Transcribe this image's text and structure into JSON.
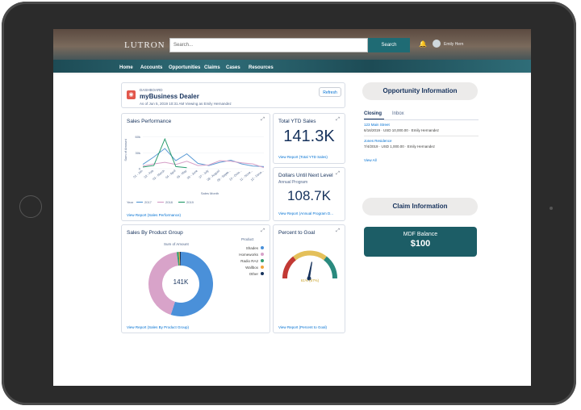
{
  "header": {
    "logo": "LUTRON",
    "search_placeholder": "Search...",
    "search_button": "Search",
    "user_name": "Emily Hern"
  },
  "nav": [
    "Home",
    "Accounts",
    "Opportunities",
    "Claims",
    "Cases",
    "Resources"
  ],
  "dashboard": {
    "label": "DASHBOARD",
    "title": "myBusiness Dealer",
    "subtitle": "As of Jun 5, 2019 10:31 AM Viewing as Emily Hernandez",
    "refresh": "Refresh"
  },
  "cards": {
    "sales_performance": {
      "title": "Sales Performance",
      "link": "View Report (Sales Performance)",
      "ylabel": "Sum of Amount",
      "xlabel": "Sales Month",
      "legend_label": "Year"
    },
    "ytd": {
      "title": "Total YTD Sales",
      "value": "141.3K",
      "link": "View Report (Total YTD Sales)"
    },
    "next_level": {
      "title": "Dollars Until Next Level",
      "subtitle": "Annual Program",
      "value": "108.7K",
      "link": "View Report (Annual Program D..."
    },
    "product_group": {
      "title": "Sales By Product Group",
      "subtitle": "Sum of Amount",
      "legend_title": "Product",
      "center": "141K",
      "link": "View Report (Sales By Product Group)"
    },
    "goal": {
      "title": "Percent to Goal",
      "center_label": "61% (57%)",
      "link": "View Report (Percent to Goal)"
    }
  },
  "chart_data": [
    {
      "type": "line",
      "title": "Sales Performance",
      "xlabel": "Sales Month",
      "ylabel": "Sum of Amount",
      "ytick_labels": [
        "60k",
        "30k",
        "0"
      ],
      "x": [
        "01 - Jan",
        "02 - Feb",
        "03 - March",
        "04 - April",
        "05 - May",
        "06 - June",
        "07 - July",
        "08 - August",
        "09 - Septe...",
        "10 - Octo...",
        "11 - Nove...",
        "12 - Dece..."
      ],
      "ylim": [
        0,
        70000
      ],
      "series": [
        {
          "name": "2017",
          "color": "#5b9bd5",
          "values": [
            8000,
            22000,
            38000,
            15000,
            28000,
            10000,
            6000,
            12000,
            16000,
            9000,
            5000,
            4000
          ]
        },
        {
          "name": "2018",
          "color": "#d6a0c8",
          "values": [
            5000,
            9000,
            12000,
            8000,
            14000,
            6000,
            7000,
            15000,
            14000,
            11000,
            9000,
            2000
          ]
        },
        {
          "name": "2019",
          "color": "#2a9d6e",
          "values": [
            3000,
            6000,
            56000,
            4000,
            2000,
            null,
            null,
            null,
            null,
            null,
            null,
            null
          ]
        }
      ]
    },
    {
      "type": "pie",
      "title": "Sales By Product Group",
      "categories": [
        "Shades",
        "Homeworks",
        "Radio RA2",
        "Wallbox",
        "Other"
      ],
      "values": [
        55,
        43,
        1,
        0.5,
        0.5
      ],
      "colors": [
        "#4a90d9",
        "#d8a3c9",
        "#2f9e6f",
        "#f2a33a",
        "#16325c"
      ]
    }
  ],
  "right_panel": {
    "opportunity_title": "Opportunity Information",
    "tabs": [
      "Closing",
      "Inbox"
    ],
    "items": [
      {
        "name": "123 Main Street",
        "detail": "6/16/2019 · USD 10,000.00 · Emily Hernandez"
      },
      {
        "name": "Jones Residence",
        "detail": "7/4/2019 · USD 1,000.00 · Emily Hernandez"
      }
    ],
    "view_all": "View All",
    "claim_title": "Claim Information",
    "mdf_label": "MDF Balance",
    "mdf_value": "$100"
  },
  "colors": {
    "accent": "#1c5d66",
    "link": "#0070d2",
    "text": "#16325c"
  }
}
